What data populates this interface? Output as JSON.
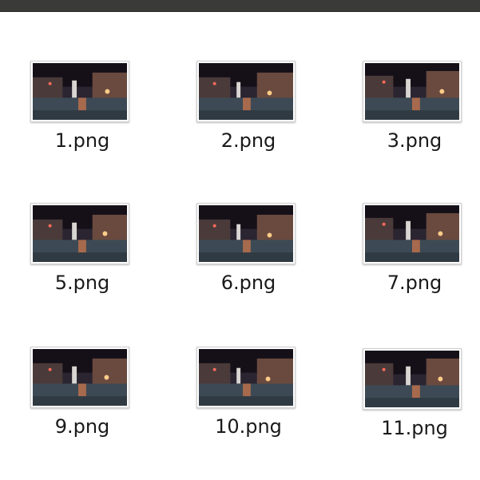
{
  "files": [
    {
      "name": "1.png"
    },
    {
      "name": "2.png"
    },
    {
      "name": "3.png"
    },
    {
      "name": "5.png"
    },
    {
      "name": "6.png"
    },
    {
      "name": "7.png"
    },
    {
      "name": "9.png"
    },
    {
      "name": "10.png"
    },
    {
      "name": "11.png"
    }
  ],
  "thumbnail_icon": "night-street-image-thumbnail-icon"
}
